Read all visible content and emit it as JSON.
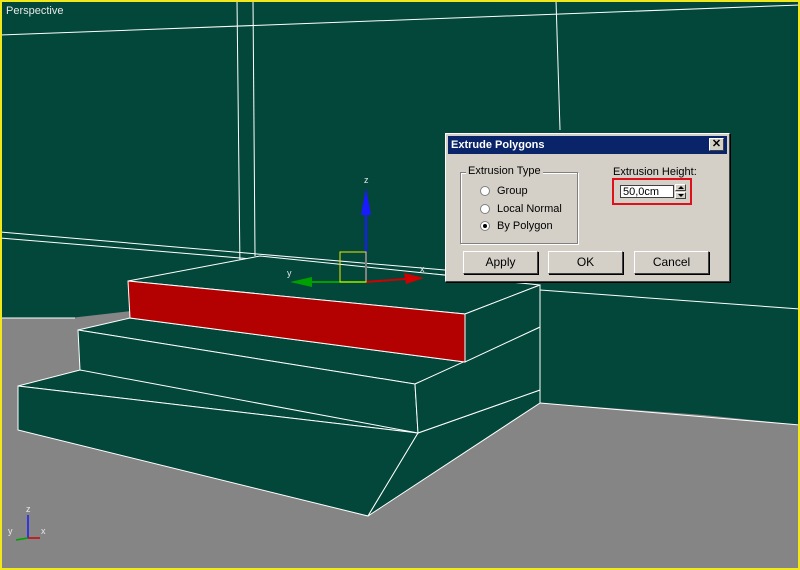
{
  "viewport": {
    "label": "Perspective",
    "gizmo_axes": {
      "x": "x",
      "y": "y",
      "z": "z"
    },
    "corner_axes": {
      "x": "x",
      "y": "y",
      "z": "z"
    }
  },
  "colors": {
    "wall": "#02473a",
    "floor": "#858585",
    "edges": "#ffffff",
    "selected_face": "#b30000",
    "viewport_border": "#f0e81a"
  },
  "dialog": {
    "title": "Extrude Polygons",
    "close_label": "✕",
    "extrusion_type": {
      "title": "Extrusion Type",
      "options": [
        "Group",
        "Local Normal",
        "By Polygon"
      ],
      "selected": "By Polygon"
    },
    "extrusion_height": {
      "label": "Extrusion Height:",
      "value": "50,0cm"
    },
    "buttons": {
      "apply": "Apply",
      "ok": "OK",
      "cancel": "Cancel"
    }
  }
}
